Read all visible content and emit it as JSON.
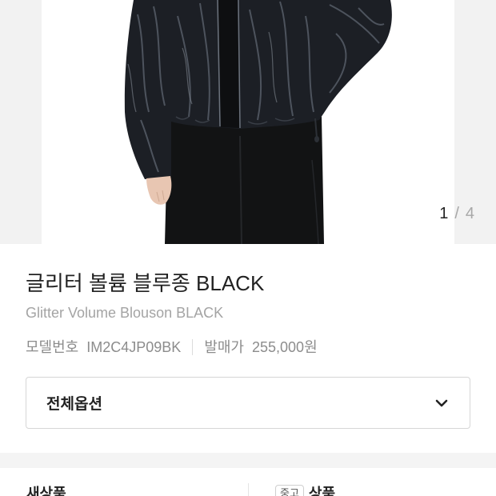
{
  "theme": {
    "text_primary": "#222222",
    "text_subtle": "#a4a4a4",
    "text_meta": "#8c8c8c",
    "border": "#d6d6d6",
    "section_band": "#f4f4f4",
    "gallery_bg": "#f2f2f2"
  },
  "gallery": {
    "current_index": "1",
    "separator": "/",
    "total": "4"
  },
  "product": {
    "title": "글리터 볼륨 블루종 BLACK",
    "subtitle": "Glitter Volume Blouson BLACK",
    "model_number_label": "모델번호",
    "model_number": "IM2C4JP09BK",
    "release_price_label": "발매가",
    "release_price": "255,000원"
  },
  "option_select": {
    "label": "전체옵션",
    "icon": "chevron-down-icon"
  },
  "condition_tabs": [
    {
      "label": "새상품"
    },
    {
      "badge": "중고",
      "label": "상품"
    }
  ]
}
